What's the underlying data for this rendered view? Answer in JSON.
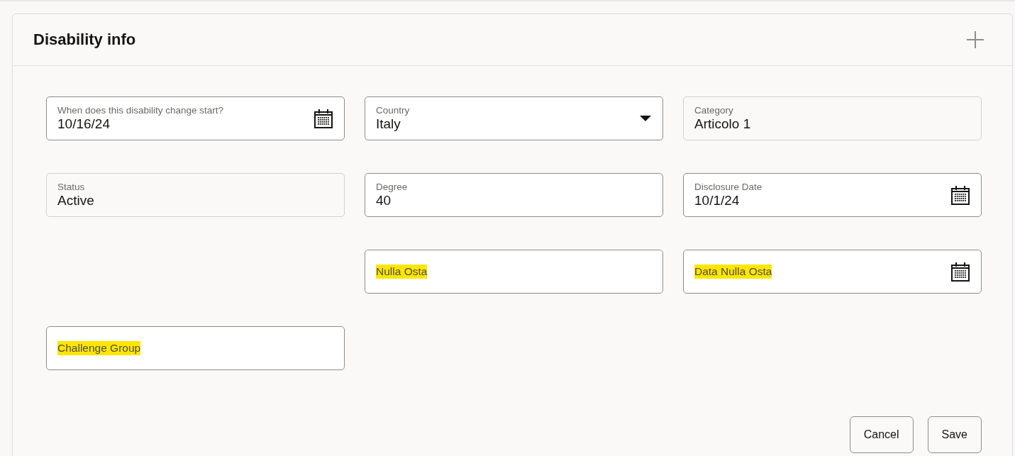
{
  "header": {
    "title": "Disability info"
  },
  "rows": [
    {
      "fields": [
        {
          "kind": "date",
          "label": "When does this disability change start?",
          "value": "10/16/24",
          "highlighted": false
        },
        {
          "kind": "select",
          "label": "Country",
          "value": "Italy",
          "highlighted": false
        },
        {
          "kind": "readonly",
          "label": "Category",
          "value": "Articolo 1",
          "highlighted": false
        }
      ]
    },
    {
      "fields": [
        {
          "kind": "readonly",
          "label": "Status",
          "value": "Active",
          "highlighted": false
        },
        {
          "kind": "text",
          "label": "Degree",
          "value": "40",
          "highlighted": false
        },
        {
          "kind": "date",
          "label": "Disclosure Date",
          "value": "10/1/24",
          "highlighted": false
        }
      ]
    },
    {
      "fields": [
        {
          "kind": "empty"
        },
        {
          "kind": "text",
          "label": "Nulla Osta",
          "highlighted": true
        },
        {
          "kind": "date",
          "label": "Data Nulla Osta",
          "highlighted": true
        }
      ]
    },
    {
      "fields": [
        {
          "kind": "text",
          "label": "Challenge Group",
          "highlighted": true
        }
      ]
    }
  ],
  "buttons": [
    {
      "label": "Cancel"
    },
    {
      "label": "Save"
    }
  ]
}
